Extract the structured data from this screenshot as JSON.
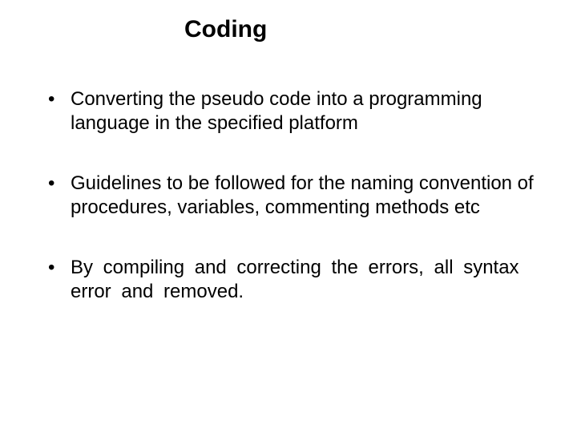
{
  "slide": {
    "title": "Coding",
    "bullets": [
      "Converting  the pseudo code into a programming language in the specified platform",
      "Guidelines to be followed for  the naming convention of procedures, variables, commenting methods  etc",
      "By  compiling  and  correcting  the  errors,  all syntax  error  and  removed."
    ]
  }
}
